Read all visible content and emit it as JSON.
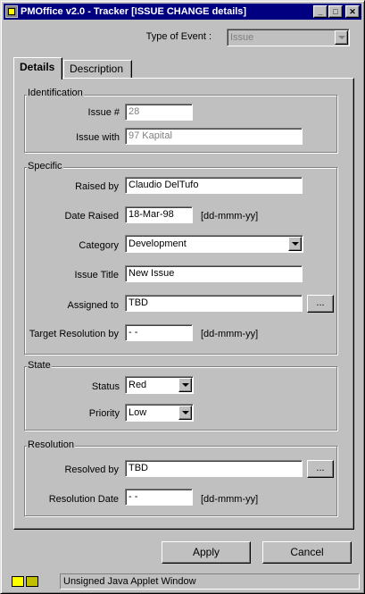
{
  "window": {
    "title": "PMOffice v2.0 - Tracker [ISSUE CHANGE details]",
    "minimize": "_",
    "maximize": "□",
    "close": "✕"
  },
  "event": {
    "label": "Type of Event :",
    "value": "Issue"
  },
  "tabs": [
    {
      "label": "Details",
      "active": true
    },
    {
      "label": "Description",
      "active": false
    }
  ],
  "identification": {
    "title": "Identification",
    "issue_no_label": "Issue #",
    "issue_no_value": "28",
    "issue_with_label": "Issue with",
    "issue_with_value": "97 Kapital"
  },
  "specific": {
    "title": "Specific",
    "raised_by_label": "Raised by",
    "raised_by_value": "Claudio DelTufo",
    "date_raised_label": "Date Raised",
    "date_raised_value": "18-Mar-98",
    "date_raised_hint": "[dd-mmm-yy]",
    "category_label": "Category",
    "category_value": "Development",
    "issue_title_label": "Issue Title",
    "issue_title_value": "New Issue",
    "assigned_to_label": "Assigned to",
    "assigned_to_value": "TBD",
    "assigned_browse": "...",
    "target_resolution_label": "Target Resolution by",
    "target_resolution_value": " -   -",
    "target_resolution_hint": "[dd-mmm-yy]"
  },
  "state": {
    "title": "State",
    "status_label": "Status",
    "status_value": "Red",
    "priority_label": "Priority",
    "priority_value": "Low"
  },
  "resolution": {
    "title": "Resolution",
    "resolved_by_label": "Resolved by",
    "resolved_by_value": "TBD",
    "resolved_browse": "...",
    "resolution_date_label": "Resolution Date",
    "resolution_date_value": " -   -",
    "resolution_date_hint": "[dd-mmm-yy]"
  },
  "buttons": {
    "apply": "Apply",
    "cancel": "Cancel"
  },
  "status_bar": {
    "text": "Unsigned Java Applet Window",
    "icon": "java-applet-icon"
  }
}
